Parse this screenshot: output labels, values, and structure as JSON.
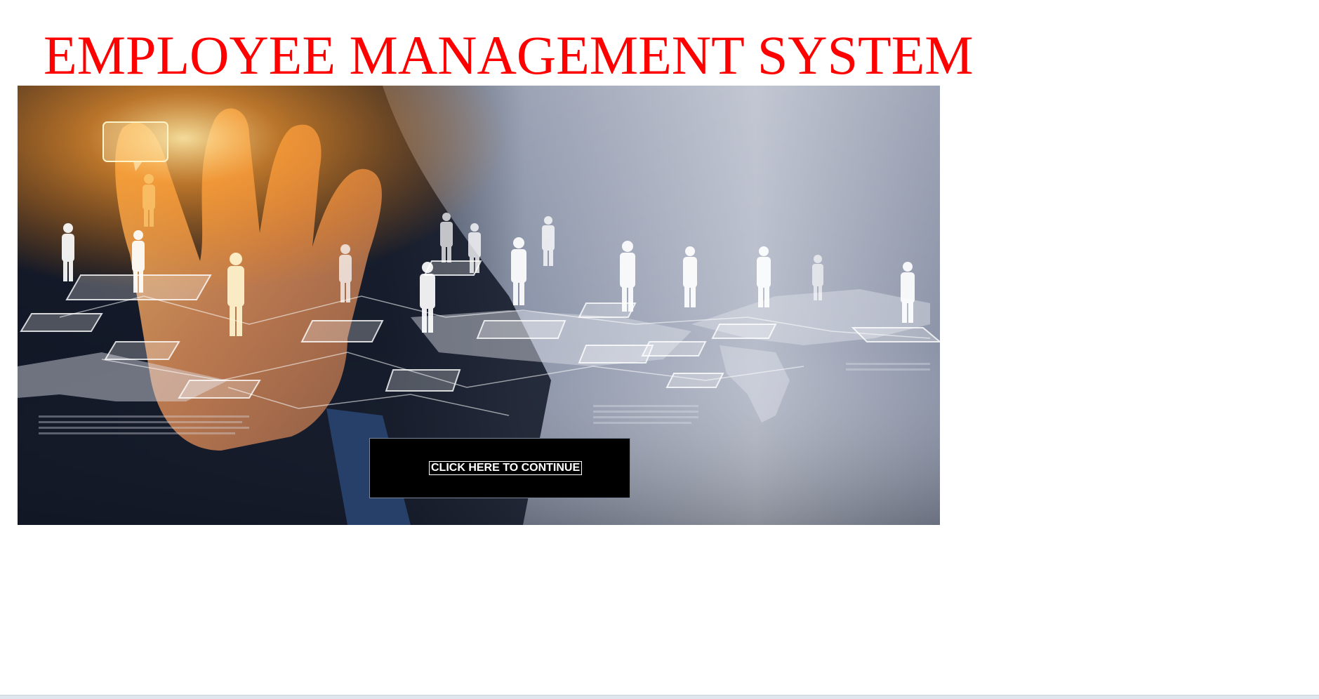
{
  "page": {
    "title": "EMPLOYEE MANAGEMENT SYSTEM",
    "title_color": "#ff0000"
  },
  "hero": {
    "image_description_icon": "business-network-people-icon",
    "accent_colors": {
      "glow": "#ffb347",
      "background_light": "#c8ccd6",
      "background_dark": "#1b2233"
    }
  },
  "continue": {
    "button_label": "CLICK HERE TO CONTINUE"
  }
}
